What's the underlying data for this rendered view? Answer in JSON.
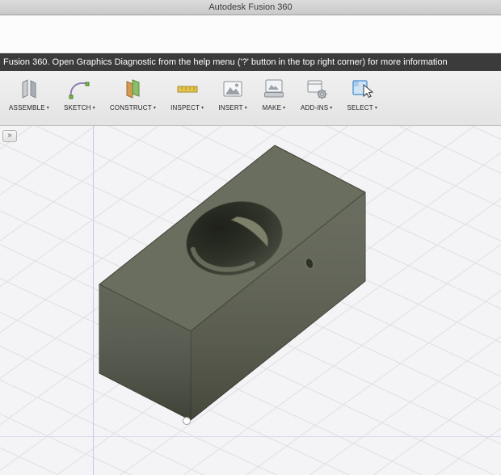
{
  "window": {
    "title": "Autodesk Fusion 360"
  },
  "notice": {
    "message": "Fusion 360. Open Graphics Diagnostic from the help menu ('?' button in the top right corner) for more information"
  },
  "toolbar": {
    "caret": "▾",
    "items": [
      {
        "label": "ASSEMBLE",
        "icon": "assemble-icon"
      },
      {
        "label": "SKETCH",
        "icon": "sketch-icon"
      },
      {
        "label": "CONSTRUCT",
        "icon": "construct-icon"
      },
      {
        "label": "INSPECT",
        "icon": "inspect-icon"
      },
      {
        "label": "INSERT",
        "icon": "insert-icon"
      },
      {
        "label": "MAKE",
        "icon": "make-icon"
      },
      {
        "label": "ADD-INS",
        "icon": "add-ins-icon"
      },
      {
        "label": "SELECT",
        "icon": "select-icon"
      }
    ]
  },
  "viewport": {
    "browser_toggle_glyph": "»",
    "grid": {
      "background": "#f4f4f6",
      "line": "#dfdfe3",
      "axis_vertical": "#c7c7ea",
      "axis_horizontal": "#d9d9ef"
    },
    "model": {
      "name": "block-with-cylindrical-recess",
      "colors": {
        "top": "#6a6e5e",
        "right": "#585c4c",
        "left": "#505446",
        "hole": "#363a2e",
        "hole_wall": "#6f7361",
        "slot": "#7d816c",
        "edge": "#3d4035"
      }
    }
  }
}
